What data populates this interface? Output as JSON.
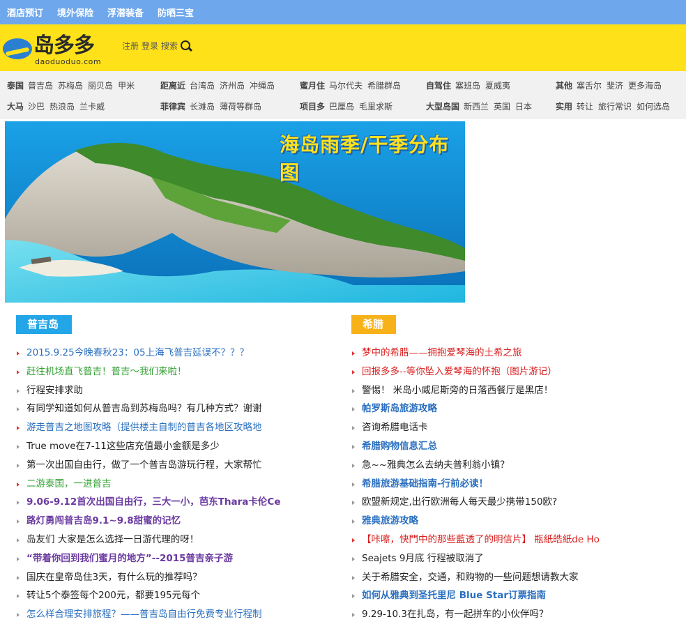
{
  "topnav": [
    "酒店预订",
    "境外保险",
    "浮潜装备",
    "防晒三宝"
  ],
  "logo": {
    "text": "岛多多",
    "sub": "daoduoduo.com"
  },
  "header_links": {
    "register": "注册",
    "login": "登录",
    "search": "搜索"
  },
  "categories": {
    "row1": [
      {
        "label": "泰国",
        "links": [
          "普吉岛",
          "苏梅岛",
          "丽贝岛",
          "甲米"
        ]
      },
      {
        "label": "距离近",
        "links": [
          "台湾岛",
          "济州岛",
          "冲绳岛"
        ]
      },
      {
        "label": "蜜月住",
        "links": [
          "马尔代夫",
          "希腊群岛"
        ]
      },
      {
        "label": "自驾住",
        "links": [
          "塞班岛",
          "夏威夷"
        ]
      },
      {
        "label": "其他",
        "links": [
          "塞舌尔",
          "斐济",
          "更多海岛"
        ]
      }
    ],
    "row2": [
      {
        "label": "大马",
        "links": [
          "沙巴",
          "热浪岛",
          "兰卡威"
        ]
      },
      {
        "label": "菲律宾",
        "links": [
          "长滩岛",
          "薄荷等群岛"
        ]
      },
      {
        "label": "项目多",
        "links": [
          "巴厘岛",
          "毛里求斯"
        ]
      },
      {
        "label": "大型岛国",
        "links": [
          "新西兰",
          "英国",
          "日本"
        ]
      },
      {
        "label": "实用",
        "links": [
          "转让",
          "旅行常识",
          "如何选岛"
        ]
      }
    ]
  },
  "banner": {
    "title": "海岛雨季/干季分布图"
  },
  "left_column": {
    "title": "普吉岛",
    "items": [
      {
        "text": "2015.9.25今晚春秋23：05上海飞普吉延误不？？？",
        "style": "blue"
      },
      {
        "text": "赶往机场直飞普吉！普吉～我们来啦！",
        "style": "green"
      },
      {
        "text": "行程安排求助",
        "style": "dark"
      },
      {
        "text": "有同学知道如何从普吉岛到苏梅岛吗？有几种方式？谢谢",
        "style": "dark"
      },
      {
        "text": "游走普吉之地图攻略（提供楼主自制的普吉各地区攻略地",
        "style": "blue"
      },
      {
        "text": "True move在7-11这些店充值最小金额是多少",
        "style": "dark"
      },
      {
        "text": "第一次出国自由行，做了一个普吉岛游玩行程，大家帮忙",
        "style": "dark"
      },
      {
        "text": "二游泰国，一进普吉",
        "style": "green"
      },
      {
        "text": "9.06-9.12首次出国自由行，三大一小，芭东Thara卡伦Ce",
        "style": "purple"
      },
      {
        "text": "路灯勇闯普吉岛9.1~9.8甜蜜的记忆",
        "style": "purple"
      },
      {
        "text": "岛友们 大家是怎么选择一日游代理的呀！",
        "style": "dark"
      },
      {
        "text": "“带着你回到我们蜜月的地方”--2015普吉亲子游",
        "style": "purple"
      },
      {
        "text": "国庆在皇帝岛住3天，有什么玩的推荐吗？",
        "style": "dark"
      },
      {
        "text": "转让5个泰签每个200元，都要195元每个",
        "style": "dark"
      },
      {
        "text": "怎么样合理安排旅程？——普吉岛自由行免费专业行程制",
        "style": "blue"
      }
    ]
  },
  "right_column": {
    "title": "希腊",
    "items": [
      {
        "text": "梦中的希腊——拥抱爱琴海的土希之旅",
        "style": "red"
      },
      {
        "text": "回报多多--等你坠入爱琴海的怀抱（图片游记）",
        "style": "red"
      },
      {
        "text": "警惕！ 米岛小威尼斯旁的日落西餐厅是黑店！",
        "style": "dark"
      },
      {
        "text": "帕罗斯岛旅游攻略",
        "style": "bblue"
      },
      {
        "text": "咨询希腊电话卡",
        "style": "dark"
      },
      {
        "text": "希腊购物信息汇总",
        "style": "bblue"
      },
      {
        "text": "急~~雅典怎么去纳夫普利翁小镇？",
        "style": "dark"
      },
      {
        "text": "希腊旅游基础指南-行前必读！",
        "style": "bblue"
      },
      {
        "text": "欧盟新规定,出行欧洲每人每天最少携带150欧?",
        "style": "dark"
      },
      {
        "text": "雅典旅游攻略",
        "style": "bblue"
      },
      {
        "text": "【咔嚓，快門中的那些藍透了的明信片】 瓶紙皓紙de Ho",
        "style": "red"
      },
      {
        "text": "Seajets 9月底 行程被取消了",
        "style": "dark"
      },
      {
        "text": "关于希腊安全，交通，和购物的一些问题想请教大家",
        "style": "dark"
      },
      {
        "text": "如何从雅典到圣托里尼 Blue Star订票指南",
        "style": "bblue"
      },
      {
        "text": "9.29-10.3在扎岛，有一起拼车的小伙伴吗？",
        "style": "dark"
      }
    ]
  }
}
